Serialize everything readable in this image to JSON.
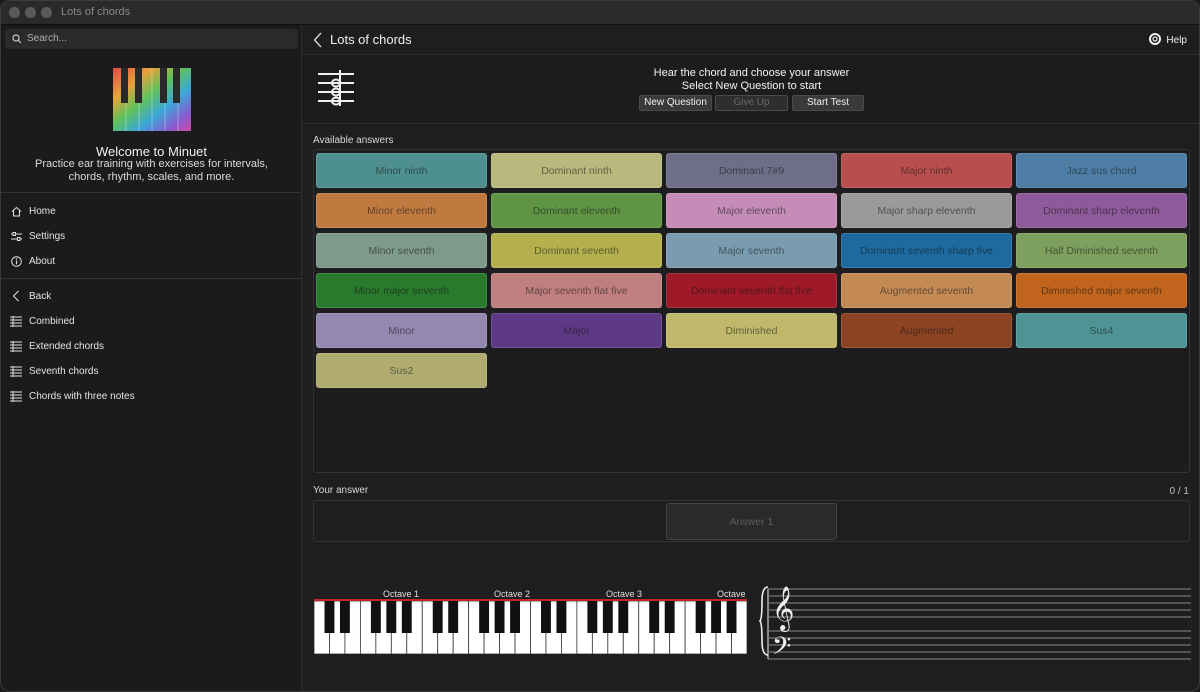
{
  "window": {
    "title": "Lots of chords"
  },
  "sidebar": {
    "search_placeholder": "Search...",
    "welcome_title": "Welcome to Minuet",
    "welcome_text": "Practice ear training with exercises for intervals, chords, rhythm, scales, and more.",
    "main_nav": [
      {
        "label": "Home",
        "icon": "home-icon"
      },
      {
        "label": "Settings",
        "icon": "sliders-icon"
      },
      {
        "label": "About",
        "icon": "info-icon"
      }
    ],
    "sub_nav": [
      {
        "label": "Back",
        "icon": "chevron-left-icon"
      },
      {
        "label": "Combined",
        "icon": "staff-icon"
      },
      {
        "label": "Extended chords",
        "icon": "staff-icon"
      },
      {
        "label": "Seventh chords",
        "icon": "staff-icon"
      },
      {
        "label": "Chords with three notes",
        "icon": "staff-icon"
      }
    ]
  },
  "toolbar": {
    "title": "Lots of chords",
    "help_label": "Help"
  },
  "exercise": {
    "prompt": "Hear the chord and choose your answer",
    "status": "Select New Question to start",
    "new_question": "New Question",
    "give_up": "Give Up",
    "start_test": "Start Test"
  },
  "answers": {
    "label": "Available answers",
    "items": [
      {
        "label": "Minor ninth",
        "color": "#4e8f8f"
      },
      {
        "label": "Dominant ninth",
        "color": "#b9b97e"
      },
      {
        "label": "Dominant 7#9",
        "color": "#6e6e88"
      },
      {
        "label": "Major ninth",
        "color": "#b84e4e"
      },
      {
        "label": "Jazz sus chord",
        "color": "#4e7ea6"
      },
      {
        "label": "Minor eleventh",
        "color": "#c07a40"
      },
      {
        "label": "Dominant eleventh",
        "color": "#5f9444"
      },
      {
        "label": "Major eleventh",
        "color": "#c48cb6"
      },
      {
        "label": "Major sharp eleventh",
        "color": "#9a9a9a"
      },
      {
        "label": "Dominant sharp eleventh",
        "color": "#8f5a9a"
      },
      {
        "label": "Minor seventh",
        "color": "#7d9a8a"
      },
      {
        "label": "Dominant seventh",
        "color": "#b4b04e"
      },
      {
        "label": "Major seventh",
        "color": "#7a9cb0"
      },
      {
        "label": "Dominant seventh sharp five",
        "color": "#1e6aa0"
      },
      {
        "label": "Half Diminished seventh",
        "color": "#7ea05e"
      },
      {
        "label": "Minor major seventh",
        "color": "#2a7a2e"
      },
      {
        "label": "Major seventh flat five",
        "color": "#c07f7f"
      },
      {
        "label": "Dominant seventh flat five",
        "color": "#9e1a28"
      },
      {
        "label": "Augmented seventh",
        "color": "#c48a56"
      },
      {
        "label": "Diminished major seventh",
        "color": "#c0641e"
      },
      {
        "label": "Minor",
        "color": "#9488b0"
      },
      {
        "label": "Major",
        "color": "#5e3a86"
      },
      {
        "label": "Diminished",
        "color": "#c0b86a"
      },
      {
        "label": "Augmented",
        "color": "#8c4422"
      },
      {
        "label": "Sus4",
        "color": "#4e9494"
      },
      {
        "label": "Sus2",
        "color": "#b0ac70"
      }
    ]
  },
  "your_answer": {
    "label": "Your answer",
    "count": "0 / 1",
    "slot_label": "Answer 1"
  },
  "keyboard": {
    "octaves": [
      "Octave 1",
      "Octave 2",
      "Octave 3",
      "Octave"
    ]
  }
}
